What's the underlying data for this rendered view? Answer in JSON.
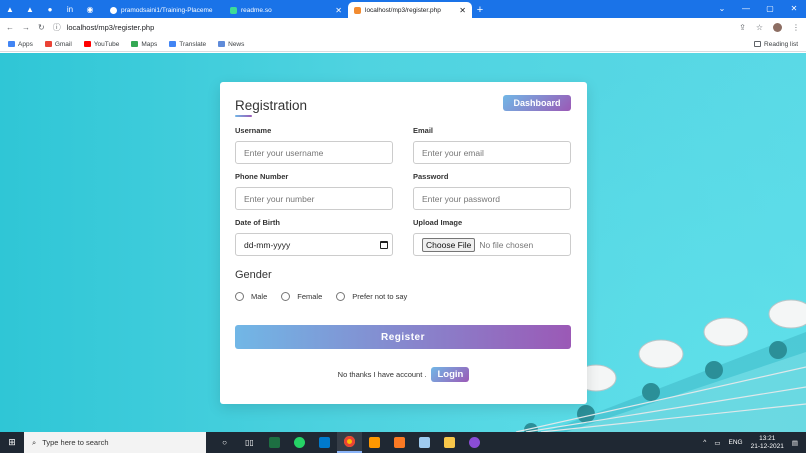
{
  "browser": {
    "tabs": [
      {
        "label": "pramodsaini1/Training-Placeme",
        "active": false
      },
      {
        "label": "readme.so",
        "active": false
      },
      {
        "label": "localhost/mp3/register.php",
        "active": true
      }
    ],
    "url": "localhost/mp3/register.php",
    "bookmarks": [
      "Apps",
      "Gmail",
      "YouTube",
      "Maps",
      "Translate",
      "News"
    ],
    "reading_list": "Reading list"
  },
  "form": {
    "title": "Registration",
    "dashboard_label": "Dashboard",
    "fields": {
      "username": {
        "label": "Username",
        "placeholder": "Enter your username"
      },
      "email": {
        "label": "Email",
        "placeholder": "Enter your email"
      },
      "phone": {
        "label": "Phone Number",
        "placeholder": "Enter your number"
      },
      "password": {
        "label": "Password",
        "placeholder": "Enter your password"
      },
      "dob": {
        "label": "Date of Birth",
        "value": "dd-mm-yyyy"
      },
      "image": {
        "label": "Upload Image",
        "button": "Choose File",
        "status": "No file chosen"
      }
    },
    "gender": {
      "title": "Gender",
      "options": [
        "Male",
        "Female",
        "Prefer not to say"
      ]
    },
    "register_label": "Register",
    "footer_text": "No thanks I have account .",
    "login_label": "Login"
  },
  "taskbar": {
    "search_placeholder": "Type here to search",
    "language": "ENG",
    "time": "13:21",
    "date": "21-12-2021"
  }
}
